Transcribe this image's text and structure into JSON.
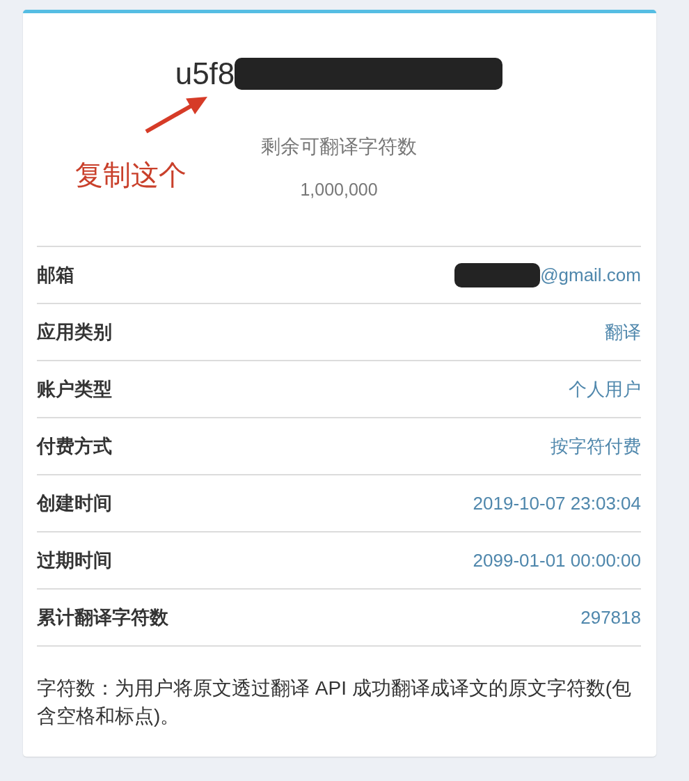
{
  "account": {
    "key_prefix": "u5f8",
    "redacted": true,
    "remaining_label": "剩余可翻译字符数",
    "remaining_value": "1,000,000"
  },
  "annotation": {
    "text": "复制这个"
  },
  "details": [
    {
      "label": "邮箱",
      "value": "@gmail.com",
      "redacted": true
    },
    {
      "label": "应用类别",
      "value": "翻译",
      "redacted": false
    },
    {
      "label": "账户类型",
      "value": "个人用户",
      "redacted": false
    },
    {
      "label": "付费方式",
      "value": "按字符付费",
      "redacted": false
    },
    {
      "label": "创建时间",
      "value": "2019-10-07 23:03:04",
      "redacted": false
    },
    {
      "label": "过期时间",
      "value": "2099-01-01 00:00:00",
      "redacted": false
    },
    {
      "label": "累计翻译字符数",
      "value": "297818",
      "redacted": false
    }
  ],
  "note": "字符数：为用户将原文透过翻译 API 成功翻译成译文的原文字符数(包含空格和标点)。"
}
